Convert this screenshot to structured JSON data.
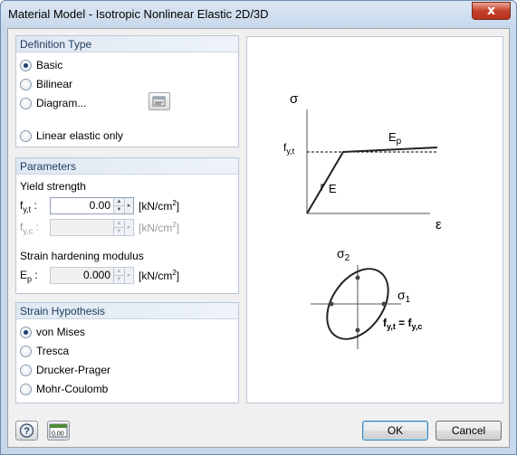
{
  "window": {
    "title": "Material Model - Isotropic Nonlinear Elastic 2D/3D",
    "close_glyph": "x"
  },
  "definition_type": {
    "header": "Definition Type",
    "options": [
      {
        "label": "Basic",
        "checked": true
      },
      {
        "label": "Bilinear",
        "checked": false
      },
      {
        "label": "Diagram...",
        "checked": false
      },
      {
        "label": "Linear elastic only",
        "checked": false
      }
    ],
    "diagram_button_icon": "edit-diagram-icon"
  },
  "parameters": {
    "header": "Parameters",
    "yield_strength_label": "Yield strength",
    "fyt": {
      "symbol": "f",
      "sub": "y,t",
      "suffix": " :",
      "value": "0.00",
      "unit": "[kN/cm",
      "unit_sup": "2",
      "unit_end": "]",
      "enabled": true
    },
    "fyc": {
      "symbol": "f",
      "sub": "y,c",
      "suffix": " :",
      "value": "",
      "unit": "[kN/cm",
      "unit_sup": "2",
      "unit_end": "]",
      "enabled": false
    },
    "hardening_label": "Strain hardening modulus",
    "ep": {
      "symbol": "E",
      "sub": "p",
      "suffix": " :",
      "value": "0.000",
      "unit": "[kN/cm",
      "unit_sup": "2",
      "unit_end": "]",
      "enabled": false
    }
  },
  "strain_hypothesis": {
    "header": "Strain Hypothesis",
    "options": [
      {
        "label": "von Mises",
        "checked": true
      },
      {
        "label": "Tresca",
        "checked": false
      },
      {
        "label": "Drucker-Prager",
        "checked": false
      },
      {
        "label": "Mohr-Coulomb",
        "checked": false
      }
    ]
  },
  "diagram": {
    "sigma": "σ",
    "epsilon": "ε",
    "fyt": "f",
    "fyt_sub": "y,t",
    "E": "E",
    "Ep": "E",
    "Ep_sub": "p",
    "sigma2": "σ",
    "sigma2_sub": "2",
    "sigma1": "σ",
    "sigma1_sub": "1",
    "eq_left": "f",
    "eq_left_sub": "y,t",
    "eq_mid": " = f",
    "eq_right_sub": "y,c"
  },
  "footer": {
    "help_icon": "help-icon",
    "units_icon": "units-decimal-icon",
    "units_icon_text": "0,00",
    "ok_label": "OK",
    "cancel_label": "Cancel"
  }
}
